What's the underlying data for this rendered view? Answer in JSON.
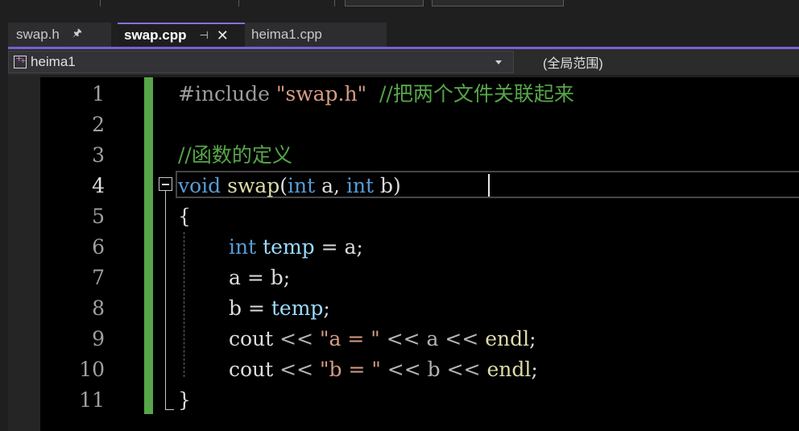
{
  "tabs": [
    {
      "label": "swap.h",
      "pin": "🖈",
      "active": false
    },
    {
      "label": "swap.cpp",
      "pin": "⊣",
      "close": "✕",
      "active": true
    },
    {
      "label": "heima1.cpp",
      "active": false
    }
  ],
  "nav": {
    "project": "heima1",
    "scope": "(全局范围)"
  },
  "line_numbers": [
    "1",
    "2",
    "3",
    "4",
    "5",
    "6",
    "7",
    "8",
    "9",
    "10",
    "11"
  ],
  "current_line": "4",
  "code": {
    "l1": {
      "directive": "#include ",
      "path": "\"swap.h\"",
      "comment": "  //把两个文件关联起来"
    },
    "l3": {
      "comment": "//函数的定义"
    },
    "l4": {
      "kw_void": "void",
      "fn": "swap",
      "open": "(",
      "kw_int1": "int",
      "p1": " a, ",
      "kw_int2": "int",
      "p2": " b)"
    },
    "l5": {
      "brace": "{"
    },
    "l6": {
      "indent": "  ",
      "kw_int": "int",
      "var": "temp",
      "rest": " = a;"
    },
    "l7": {
      "text": "a = b;"
    },
    "l8": {
      "a": "b = ",
      "var": "temp",
      "end": ";"
    },
    "l9": {
      "cout": "cout",
      "op1": " << ",
      "str": "\"a = \"",
      "op2": " << a << ",
      "fn": "endl",
      "end": ";"
    },
    "l10": {
      "cout": "cout",
      "op1": " << ",
      "str": "\"b = \"",
      "op2": " << b << ",
      "fn": "endl",
      "end": ";"
    },
    "l11": {
      "brace": "}"
    }
  },
  "colors": {
    "accent": "#7a5fd0",
    "change_bar": "#57a64a",
    "keyword": "#569cd6",
    "string": "#d69d85",
    "comment": "#57a64a",
    "function": "#dcdcaa",
    "variable": "#9cdcfe"
  },
  "icons": {
    "project": "project-icon",
    "dropdown": "chevron-down-icon",
    "fold": "collapse-icon"
  }
}
